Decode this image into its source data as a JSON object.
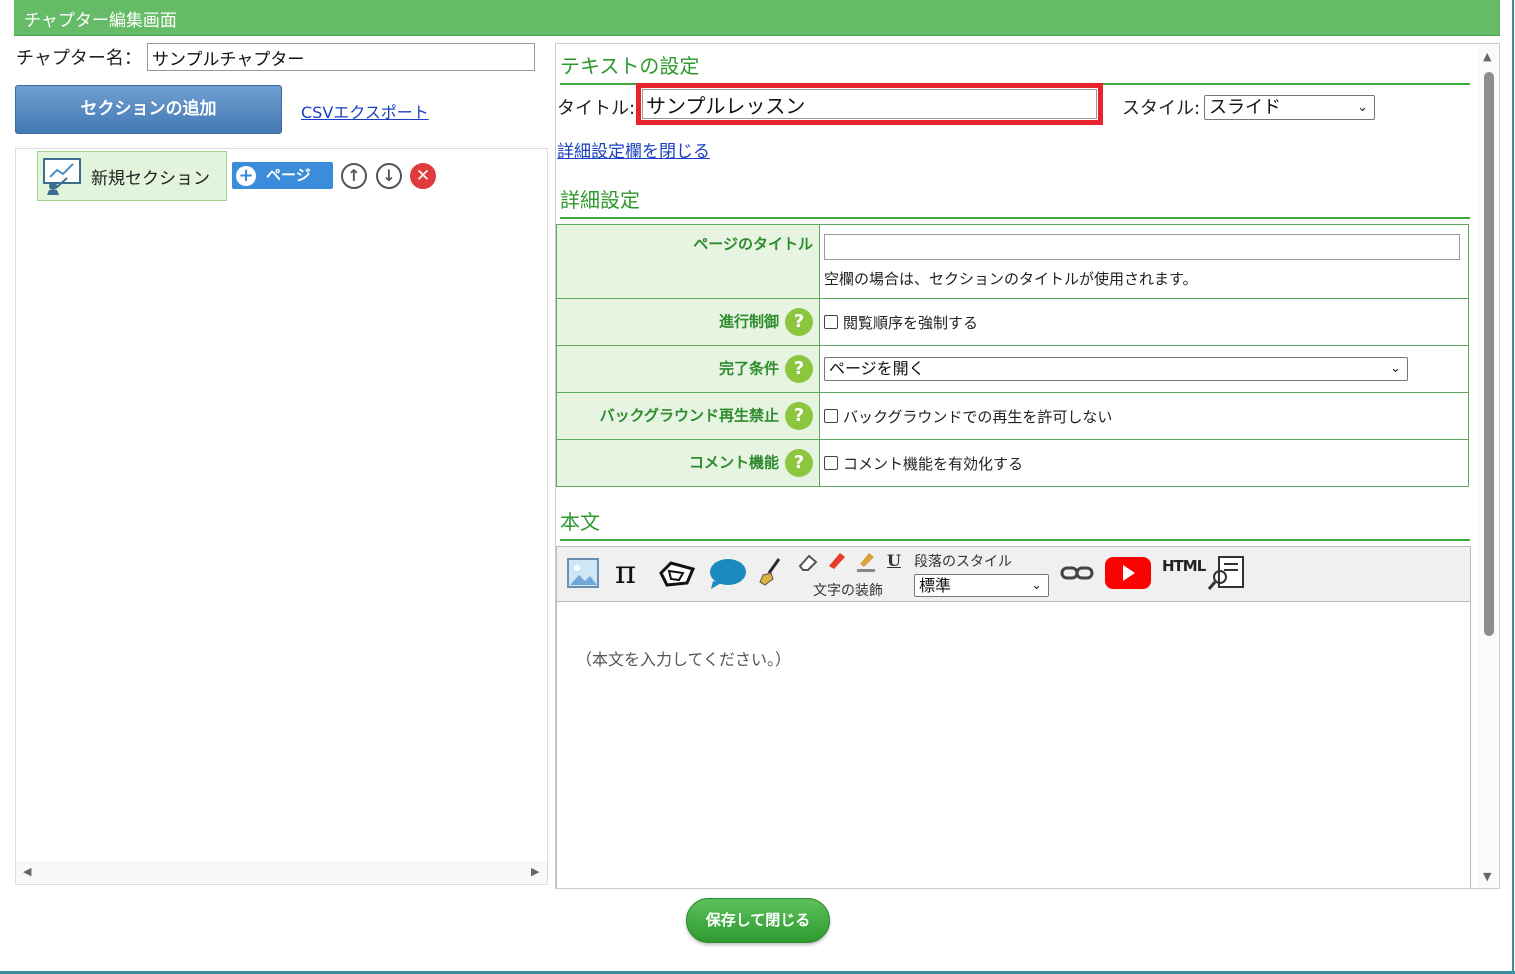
{
  "header": {
    "title": "チャプター編集画面"
  },
  "chapter": {
    "label": "チャプター名：",
    "name_value": "サンプルチャプター"
  },
  "left": {
    "add_section_label": "セクションの追加",
    "csv_export_label": "CSVエクスポート",
    "section": {
      "label": "新規セクション",
      "page_button_label": "ページ"
    }
  },
  "text_settings": {
    "heading": "テキストの設定",
    "title_label": "タイトル:",
    "title_value": "サンプルレッスン",
    "style_label": "スタイル:",
    "style_value": "スライド",
    "close_details_link": "詳細設定欄を閉じる"
  },
  "details": {
    "heading": "詳細設定",
    "rows": [
      {
        "label": "ページのタイトル",
        "hint": "空欄の場合は、セクションのタイトルが使用されます。"
      },
      {
        "label": "進行制御",
        "checkbox_label": "閲覧順序を強制する"
      },
      {
        "label": "完了条件",
        "select_value": "ページを開く"
      },
      {
        "label": "バックグラウンド再生禁止",
        "checkbox_label": "バックグラウンドでの再生を許可しない"
      },
      {
        "label": "コメント機能",
        "checkbox_label": "コメント機能を有効化する"
      }
    ]
  },
  "body_section": {
    "heading": "本文",
    "text_decoration_label": "文字の装飾",
    "paragraph_style_label": "段落のスタイル",
    "paragraph_style_value": "標準",
    "underline_glyph": "U",
    "html_tool_label": "HTML",
    "pi_glyph": "π",
    "placeholder": "（本文を入力してください。）"
  },
  "footer": {
    "save_label": "保存して閉じる"
  },
  "colors": {
    "header_green": "#66bb66",
    "heading_green": "#2b9a2b",
    "highlight_red": "#e8232b",
    "section_blue": "#4379b4"
  }
}
